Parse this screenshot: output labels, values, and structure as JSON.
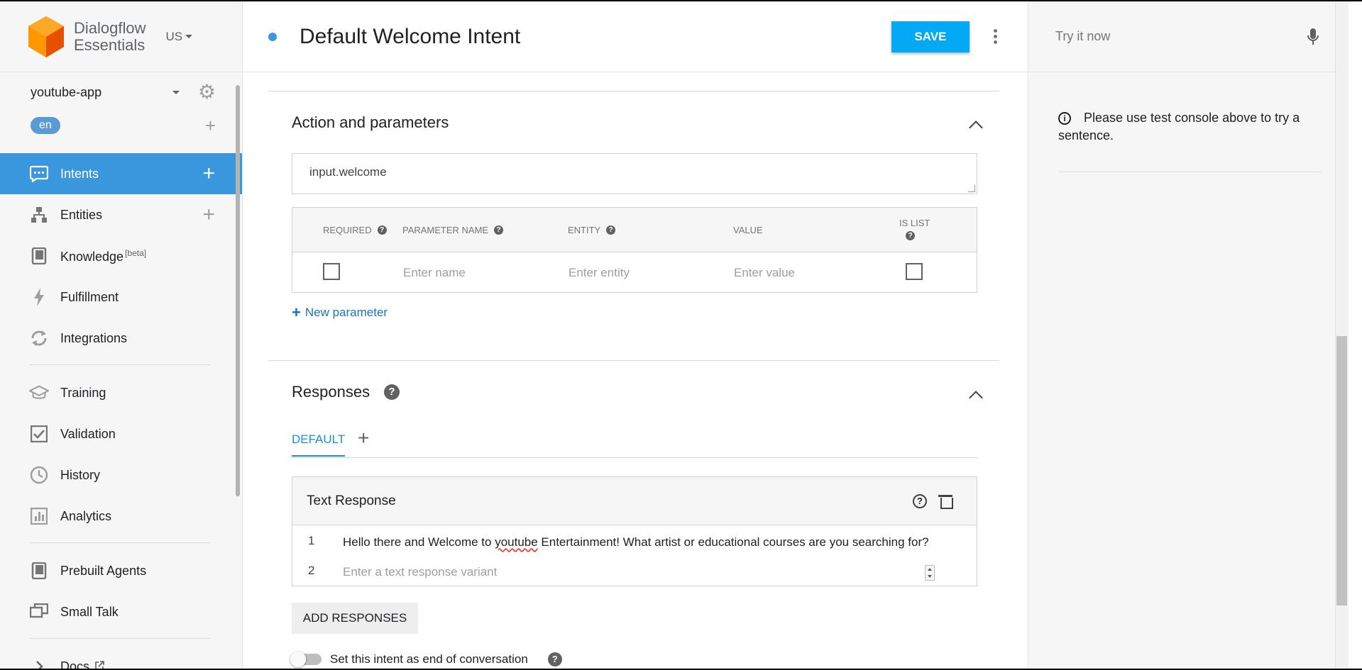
{
  "brand": {
    "line1": "Dialogflow",
    "line2": "Essentials",
    "region": "US"
  },
  "agent": {
    "name": "youtube-app",
    "language": "en"
  },
  "nav": {
    "intents": "Intents",
    "entities": "Entities",
    "knowledge": "Knowledge",
    "knowledge_badge": "[beta]",
    "fulfillment": "Fulfillment",
    "integrations": "Integrations",
    "training": "Training",
    "validation": "Validation",
    "history": "History",
    "analytics": "Analytics",
    "prebuilt_agents": "Prebuilt Agents",
    "small_talk": "Small Talk",
    "docs": "Docs"
  },
  "header": {
    "title": "Default Welcome Intent",
    "save_label": "SAVE"
  },
  "console": {
    "try_placeholder": "Try it now",
    "message": "Please use test console above to try a sentence."
  },
  "action_section": {
    "title": "Action and parameters",
    "action_value": "input.welcome",
    "columns": {
      "required": "REQUIRED",
      "param_name": "PARAMETER NAME",
      "entity": "ENTITY",
      "value": "VALUE",
      "is_list": "IS LIST"
    },
    "placeholders": {
      "name": "Enter name",
      "entity": "Enter entity",
      "value": "Enter value"
    },
    "new_parameter": "New parameter"
  },
  "responses_section": {
    "title": "Responses",
    "tab_default": "DEFAULT",
    "text_response_title": "Text Response",
    "rows": [
      {
        "num": "1",
        "text_before": "Hello there and Welcome to ",
        "text_misspelled": "youtube",
        "text_after": " Entertainment! What artist or educational courses are you searching for?"
      },
      {
        "num": "2",
        "placeholder": "Enter a text response variant"
      }
    ],
    "add_responses": "ADD RESPONSES",
    "end_conversation": "Set this intent as end of conversation"
  },
  "colors": {
    "accent": "#3a97dd",
    "save": "#03a9f4",
    "logo": "#f57c00"
  },
  "icons": [
    "logo-icon",
    "caret-down-icon",
    "gear-icon",
    "plus-icon",
    "intents-icon",
    "entities-icon",
    "knowledge-icon",
    "fulfillment-icon",
    "integrations-icon",
    "training-icon",
    "validation-icon",
    "history-icon",
    "analytics-icon",
    "prebuilt-agents-icon",
    "small-talk-icon",
    "chevron-right-icon",
    "external-link-icon",
    "kebab-menu-icon",
    "mic-icon",
    "info-icon",
    "help-icon",
    "trash-icon",
    "chevron-up-icon"
  ]
}
